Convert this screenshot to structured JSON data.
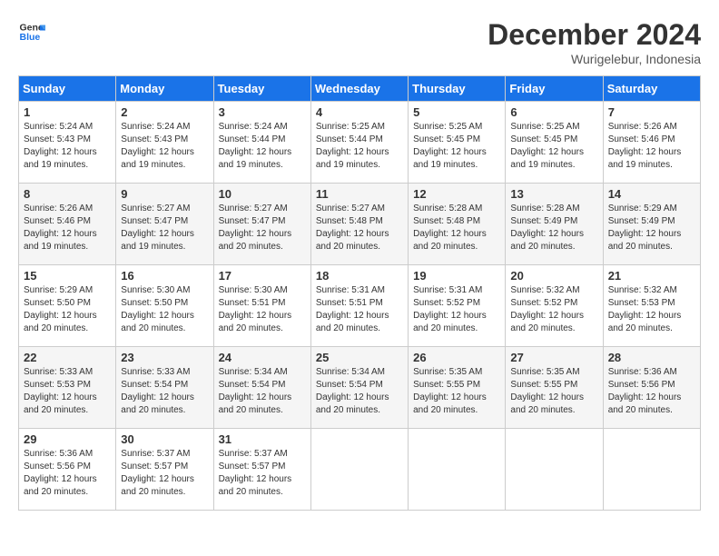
{
  "logo": {
    "line1": "General",
    "line2": "Blue"
  },
  "title": "December 2024",
  "subtitle": "Wurigelebur, Indonesia",
  "days_header": [
    "Sunday",
    "Monday",
    "Tuesday",
    "Wednesday",
    "Thursday",
    "Friday",
    "Saturday"
  ],
  "weeks": [
    [
      {
        "day": "1",
        "info": "Sunrise: 5:24 AM\nSunset: 5:43 PM\nDaylight: 12 hours\nand 19 minutes."
      },
      {
        "day": "2",
        "info": "Sunrise: 5:24 AM\nSunset: 5:43 PM\nDaylight: 12 hours\nand 19 minutes."
      },
      {
        "day": "3",
        "info": "Sunrise: 5:24 AM\nSunset: 5:44 PM\nDaylight: 12 hours\nand 19 minutes."
      },
      {
        "day": "4",
        "info": "Sunrise: 5:25 AM\nSunset: 5:44 PM\nDaylight: 12 hours\nand 19 minutes."
      },
      {
        "day": "5",
        "info": "Sunrise: 5:25 AM\nSunset: 5:45 PM\nDaylight: 12 hours\nand 19 minutes."
      },
      {
        "day": "6",
        "info": "Sunrise: 5:25 AM\nSunset: 5:45 PM\nDaylight: 12 hours\nand 19 minutes."
      },
      {
        "day": "7",
        "info": "Sunrise: 5:26 AM\nSunset: 5:46 PM\nDaylight: 12 hours\nand 19 minutes."
      }
    ],
    [
      {
        "day": "8",
        "info": "Sunrise: 5:26 AM\nSunset: 5:46 PM\nDaylight: 12 hours\nand 19 minutes."
      },
      {
        "day": "9",
        "info": "Sunrise: 5:27 AM\nSunset: 5:47 PM\nDaylight: 12 hours\nand 19 minutes."
      },
      {
        "day": "10",
        "info": "Sunrise: 5:27 AM\nSunset: 5:47 PM\nDaylight: 12 hours\nand 20 minutes."
      },
      {
        "day": "11",
        "info": "Sunrise: 5:27 AM\nSunset: 5:48 PM\nDaylight: 12 hours\nand 20 minutes."
      },
      {
        "day": "12",
        "info": "Sunrise: 5:28 AM\nSunset: 5:48 PM\nDaylight: 12 hours\nand 20 minutes."
      },
      {
        "day": "13",
        "info": "Sunrise: 5:28 AM\nSunset: 5:49 PM\nDaylight: 12 hours\nand 20 minutes."
      },
      {
        "day": "14",
        "info": "Sunrise: 5:29 AM\nSunset: 5:49 PM\nDaylight: 12 hours\nand 20 minutes."
      }
    ],
    [
      {
        "day": "15",
        "info": "Sunrise: 5:29 AM\nSunset: 5:50 PM\nDaylight: 12 hours\nand 20 minutes."
      },
      {
        "day": "16",
        "info": "Sunrise: 5:30 AM\nSunset: 5:50 PM\nDaylight: 12 hours\nand 20 minutes."
      },
      {
        "day": "17",
        "info": "Sunrise: 5:30 AM\nSunset: 5:51 PM\nDaylight: 12 hours\nand 20 minutes."
      },
      {
        "day": "18",
        "info": "Sunrise: 5:31 AM\nSunset: 5:51 PM\nDaylight: 12 hours\nand 20 minutes."
      },
      {
        "day": "19",
        "info": "Sunrise: 5:31 AM\nSunset: 5:52 PM\nDaylight: 12 hours\nand 20 minutes."
      },
      {
        "day": "20",
        "info": "Sunrise: 5:32 AM\nSunset: 5:52 PM\nDaylight: 12 hours\nand 20 minutes."
      },
      {
        "day": "21",
        "info": "Sunrise: 5:32 AM\nSunset: 5:53 PM\nDaylight: 12 hours\nand 20 minutes."
      }
    ],
    [
      {
        "day": "22",
        "info": "Sunrise: 5:33 AM\nSunset: 5:53 PM\nDaylight: 12 hours\nand 20 minutes."
      },
      {
        "day": "23",
        "info": "Sunrise: 5:33 AM\nSunset: 5:54 PM\nDaylight: 12 hours\nand 20 minutes."
      },
      {
        "day": "24",
        "info": "Sunrise: 5:34 AM\nSunset: 5:54 PM\nDaylight: 12 hours\nand 20 minutes."
      },
      {
        "day": "25",
        "info": "Sunrise: 5:34 AM\nSunset: 5:54 PM\nDaylight: 12 hours\nand 20 minutes."
      },
      {
        "day": "26",
        "info": "Sunrise: 5:35 AM\nSunset: 5:55 PM\nDaylight: 12 hours\nand 20 minutes."
      },
      {
        "day": "27",
        "info": "Sunrise: 5:35 AM\nSunset: 5:55 PM\nDaylight: 12 hours\nand 20 minutes."
      },
      {
        "day": "28",
        "info": "Sunrise: 5:36 AM\nSunset: 5:56 PM\nDaylight: 12 hours\nand 20 minutes."
      }
    ],
    [
      {
        "day": "29",
        "info": "Sunrise: 5:36 AM\nSunset: 5:56 PM\nDaylight: 12 hours\nand 20 minutes."
      },
      {
        "day": "30",
        "info": "Sunrise: 5:37 AM\nSunset: 5:57 PM\nDaylight: 12 hours\nand 20 minutes."
      },
      {
        "day": "31",
        "info": "Sunrise: 5:37 AM\nSunset: 5:57 PM\nDaylight: 12 hours\nand 20 minutes."
      },
      {
        "day": "",
        "info": ""
      },
      {
        "day": "",
        "info": ""
      },
      {
        "day": "",
        "info": ""
      },
      {
        "day": "",
        "info": ""
      }
    ]
  ]
}
